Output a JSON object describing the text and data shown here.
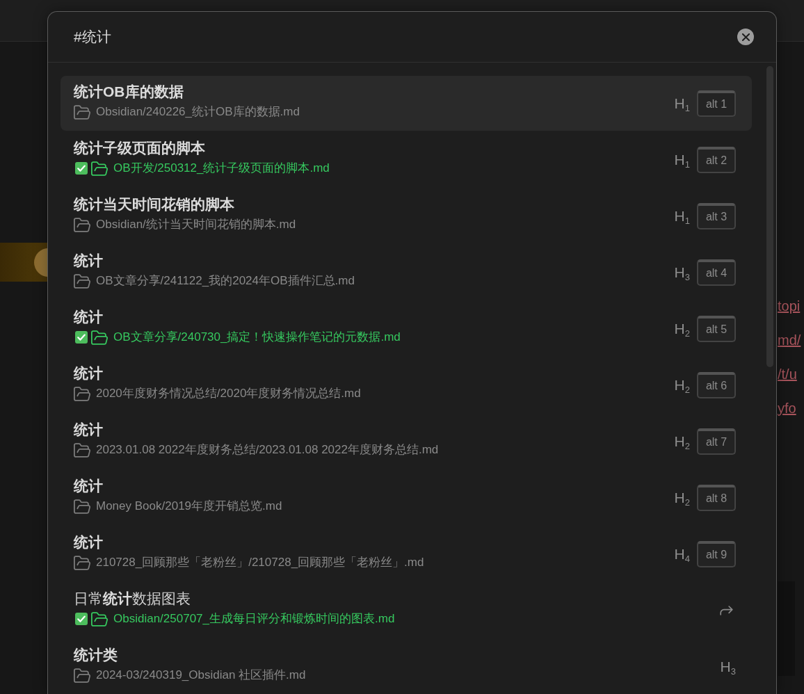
{
  "backdrop": {
    "links": [
      "topi",
      "md/",
      "/t/u",
      "yfo"
    ]
  },
  "search": {
    "value": "#统计"
  },
  "results": [
    {
      "kind": "heading",
      "title": "统计OB库的数据",
      "path": "Obsidian/240226_统计OB库的数据.md",
      "done": false,
      "heading": "H$_{1}$",
      "hotkey": "alt 1",
      "selected": true
    },
    {
      "kind": "heading",
      "title": "统计子级页面的脚本",
      "path": "OB开发/250312_统计子级页面的脚本.md",
      "done": true,
      "heading": "H$_{1}$",
      "hotkey": "alt 2",
      "selected": false
    },
    {
      "kind": "heading",
      "title": "统计当天时间花销的脚本",
      "path": "Obsidian/统计当天时间花销的脚本.md",
      "done": false,
      "heading": "H$_{1}$",
      "hotkey": "alt 3",
      "selected": false
    },
    {
      "kind": "heading",
      "title": "统计",
      "path": "OB文章分享/241122_我的2024年OB插件汇总.md",
      "done": false,
      "heading": "H$_{3}$",
      "hotkey": "alt 4",
      "selected": false
    },
    {
      "kind": "heading",
      "title": "统计",
      "path": "OB文章分享/240730_搞定！快速操作笔记的元数据.md",
      "done": true,
      "heading": "H$_{2}$",
      "hotkey": "alt 5",
      "selected": false
    },
    {
      "kind": "heading",
      "title": "统计",
      "path": "2020年度财务情况总结/2020年度财务情况总结.md",
      "done": false,
      "heading": "H$_{2}$",
      "hotkey": "alt 6",
      "selected": false
    },
    {
      "kind": "heading",
      "title": "统计",
      "path": "2023.01.08 2022年度财务总结/2023.01.08 2022年度财务总结.md",
      "done": false,
      "heading": "H$_{2}$",
      "hotkey": "alt 7",
      "selected": false
    },
    {
      "kind": "heading",
      "title": "统计",
      "path": "Money Book/2019年度开销总览.md",
      "done": false,
      "heading": "H$_{2}$",
      "hotkey": "alt 8",
      "selected": false
    },
    {
      "kind": "heading",
      "title": "统计",
      "path": "210728_回顾那些「老粉丝」/210728_回顾那些「老粉丝」.md",
      "done": false,
      "heading": "H$_{4}$",
      "hotkey": "alt 9",
      "selected": false
    },
    {
      "kind": "alias",
      "title": "日常**统计**数据图表",
      "path": "Obsidian/250707_生成每日评分和锻炼时间的图表.md",
      "done": true,
      "selected": false
    },
    {
      "kind": "heading",
      "title": "统计类",
      "path": "2024-03/240319_Obsidian 社区插件.md",
      "done": false,
      "heading": "H$_{3}$",
      "selected": false
    }
  ]
}
